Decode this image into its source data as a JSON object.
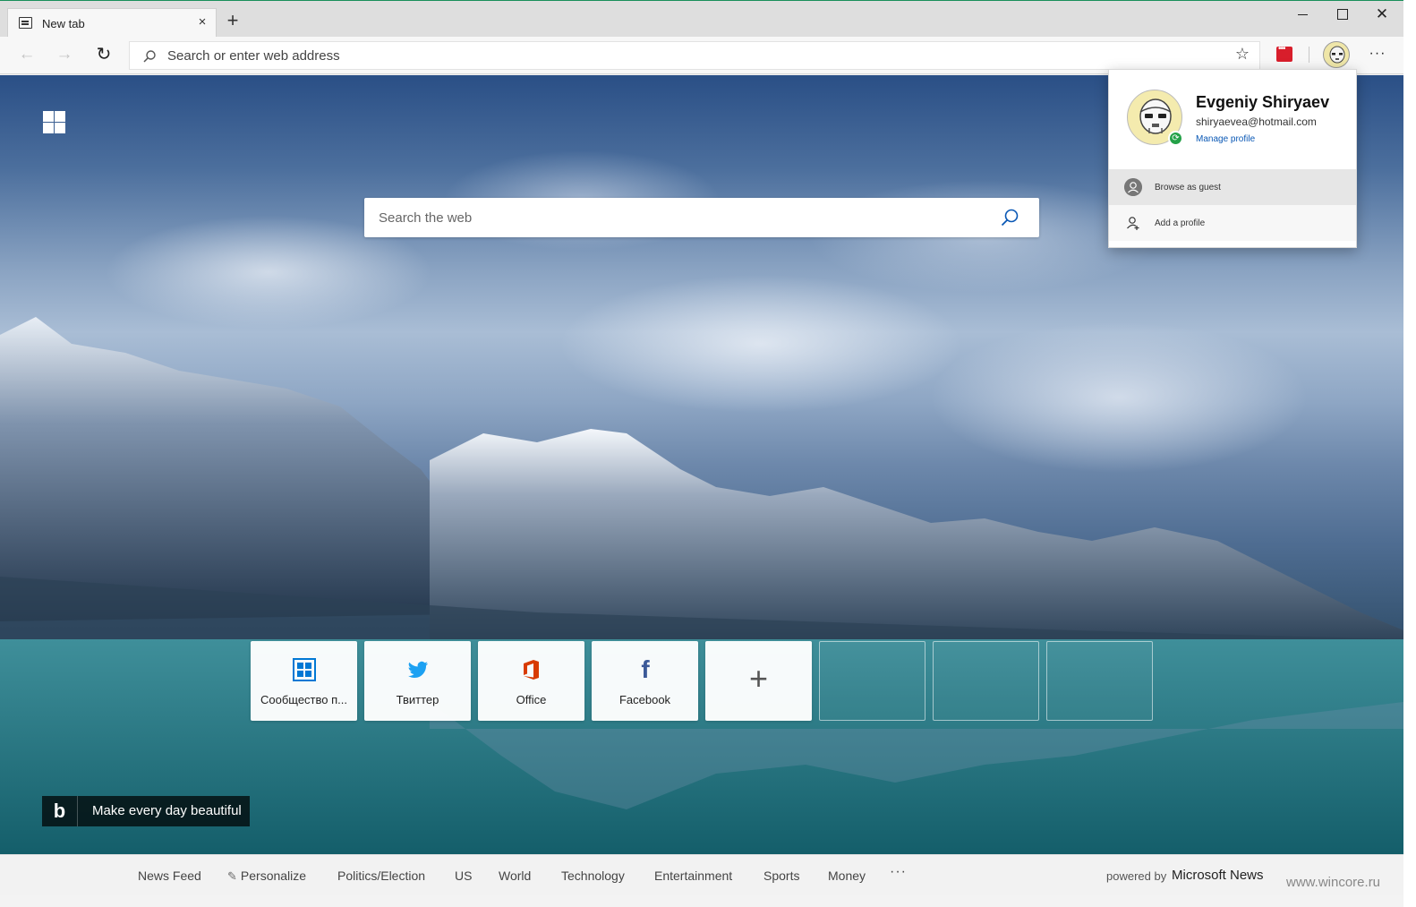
{
  "tab": {
    "title": "New tab",
    "close_glyph": "×"
  },
  "new_tab_glyph": "+",
  "window_controls": {
    "close_glyph": "✕"
  },
  "toolbar": {
    "back_glyph": "←",
    "forward_glyph": "→",
    "refresh_glyph": "↻",
    "address_placeholder": "Search or enter web address",
    "favorite_glyph": "☆",
    "more_glyph": "···"
  },
  "search": {
    "placeholder": "Search the web"
  },
  "top_sites": [
    {
      "label": "Сообщество п...",
      "icon": "windows-community-icon"
    },
    {
      "label": "Твиттер",
      "icon": "twitter-icon"
    },
    {
      "label": "Office",
      "icon": "office-icon"
    },
    {
      "label": "Facebook",
      "icon": "facebook-icon",
      "glyph": "f"
    },
    {
      "label": "",
      "icon": "add-site-icon",
      "glyph": "+"
    }
  ],
  "bing": {
    "logo": "b",
    "text": "Make every day beautiful"
  },
  "profile_flyout": {
    "name": "Evgeniy Shiryaev",
    "email": "shiryaevea@hotmail.com",
    "manage_link": "Manage profile",
    "sync_glyph": "⟳",
    "items": [
      {
        "label": "Browse as guest",
        "icon": "guest-icon"
      },
      {
        "label": "Add a profile",
        "icon": "add-profile-icon"
      }
    ]
  },
  "news_bar": {
    "items": [
      "News Feed",
      "Personalize",
      "Politics/Election",
      "US",
      "World",
      "Technology",
      "Entertainment",
      "Sports",
      "Money"
    ],
    "more_glyph": "···",
    "powered_prefix": "powered by",
    "powered_brand": "Microsoft News"
  },
  "watermark": "www.wincore.ru",
  "colors": {
    "accent": "#0a58b5",
    "twitter": "#1da1f2",
    "office": "#d83b01",
    "facebook": "#3b5998",
    "community": "#0078d4",
    "sync": "#24a148"
  }
}
